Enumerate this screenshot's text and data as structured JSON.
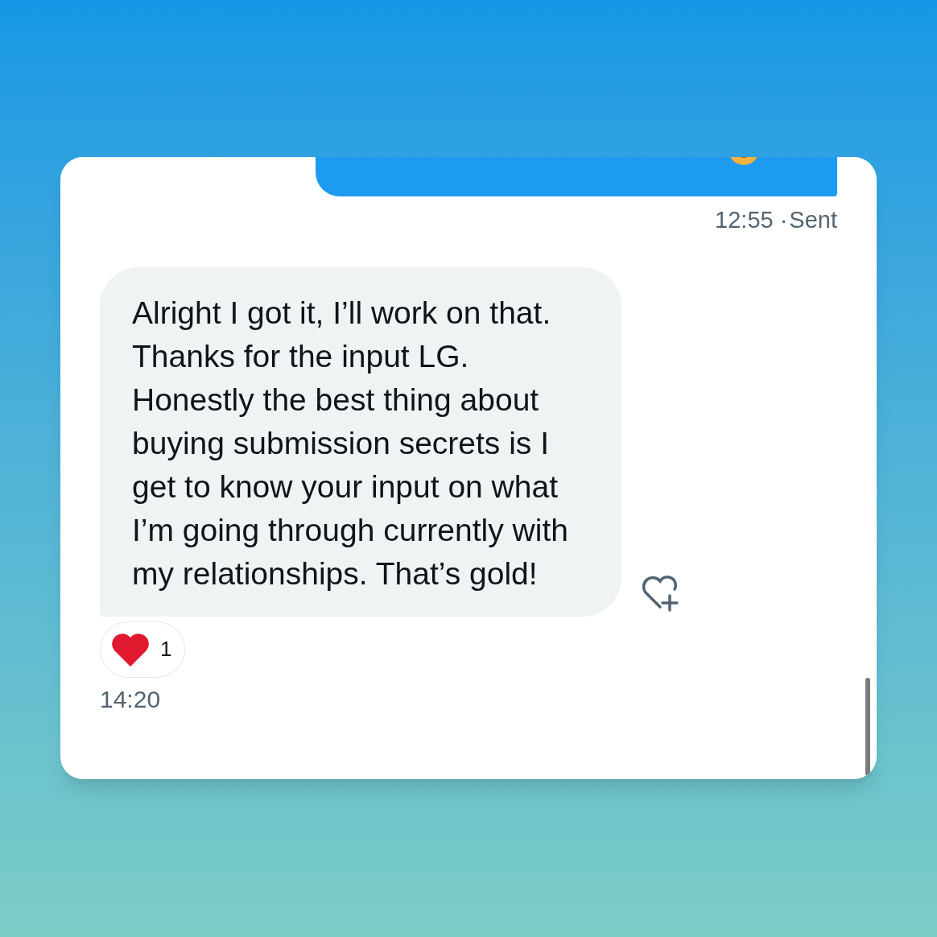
{
  "messages": [
    {
      "kind": "sent",
      "time": "12:55",
      "separator": "·",
      "status": "Sent"
    },
    {
      "kind": "received",
      "text": "Alright I got it, I’ll work on that. Thanks for the input LG. Honestly the best thing about buying submission secrets is I get to know your input on what I’m going through currently with my relationships. That’s gold!",
      "reaction": {
        "count": "1"
      },
      "time": "14:20"
    }
  ]
}
